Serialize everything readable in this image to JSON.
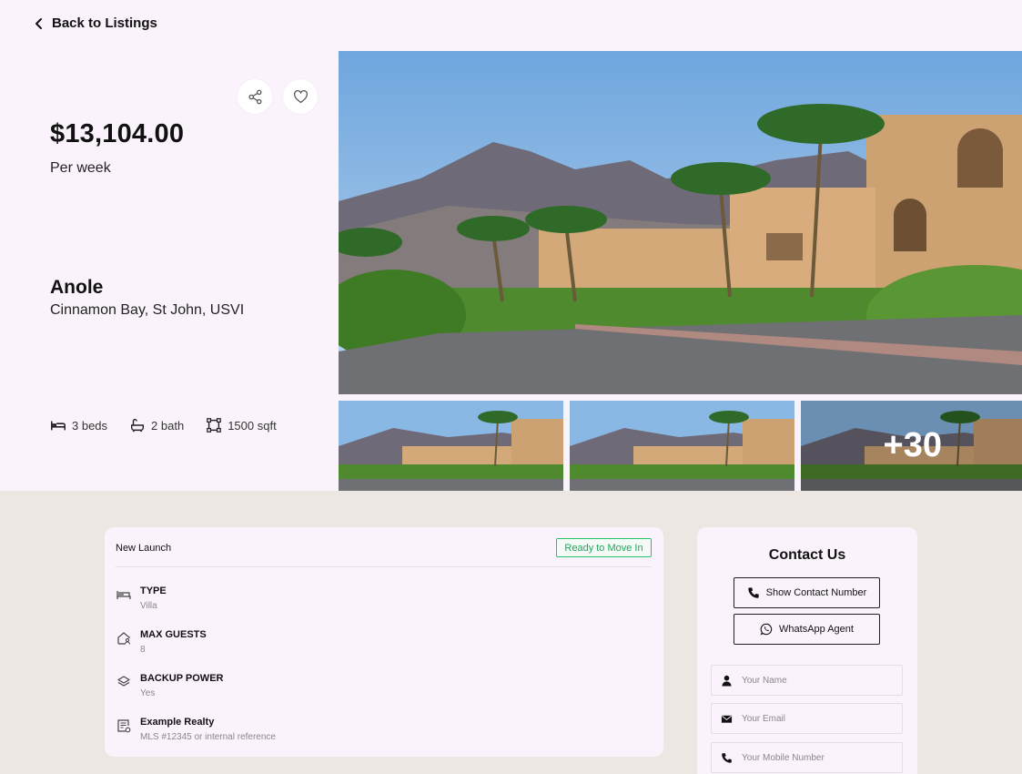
{
  "nav": {
    "back_label": "Back to Listings"
  },
  "listing": {
    "price": "$13,104.00",
    "period": "Per week",
    "name": "Anole",
    "location": "Cinnamon Bay, St John, USVI",
    "amenities": {
      "beds": "3 beds",
      "bath": "2 bath",
      "area": "1500 sqft"
    },
    "more_photos": "+30"
  },
  "details": {
    "launch_label": "New Launch",
    "status_badge": "Ready to Move In",
    "rows": [
      {
        "title": "TYPE",
        "value": "Villa",
        "icon": "bed-icon"
      },
      {
        "title": "MAX GUESTS",
        "value": "8",
        "icon": "home-user-icon"
      },
      {
        "title": "BACKUP POWER",
        "value": "Yes",
        "icon": "layers-icon"
      },
      {
        "title": "Example Realty",
        "value": "MLS #12345 or internal reference",
        "icon": "document-icon"
      }
    ]
  },
  "contact": {
    "title": "Contact Us",
    "show_number_label": "Show Contact Number",
    "whatsapp_label": "WhatsApp Agent",
    "name_placeholder": "Your Name",
    "email_placeholder": "Your Email",
    "phone_placeholder": "Your Mobile Number"
  },
  "colors": {
    "hero_bg": "#fbf3fc",
    "page_bg": "#ece7e3",
    "badge_green": "#23c26b"
  }
}
